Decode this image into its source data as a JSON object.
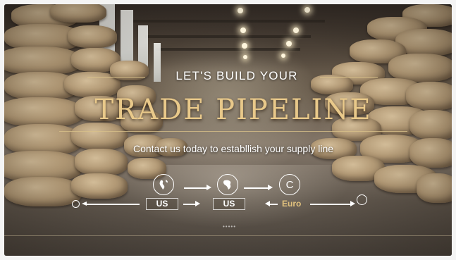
{
  "banner": {
    "subtitle": "LET'S BUILD YOUR",
    "title": "TRADE PIPELINE",
    "tagline": "Contact us today to establlish your supply line",
    "accent_color": "#e9c98a"
  },
  "flow": {
    "icons": [
      "globe-americas-icon",
      "globe-africa-icon",
      "currency-c-icon"
    ],
    "currency_symbol": "C",
    "labels": [
      "US",
      "US",
      "Euro"
    ]
  }
}
